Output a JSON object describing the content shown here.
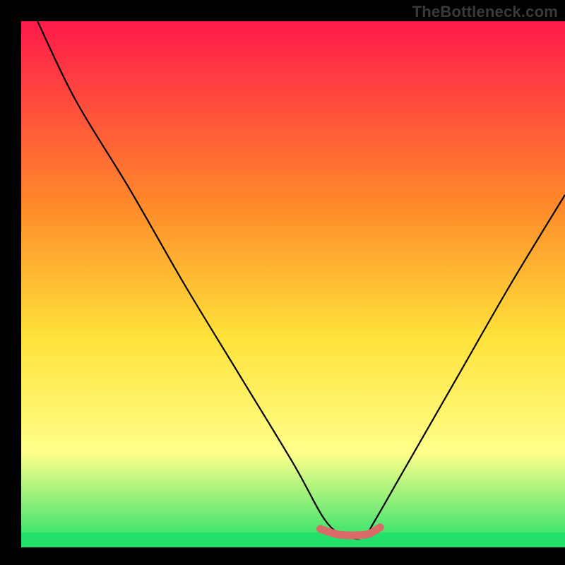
{
  "watermark": "TheBottleneck.com",
  "chart_data": {
    "type": "line",
    "title": "",
    "xlabel": "",
    "ylabel": "",
    "xlim": [
      0,
      100
    ],
    "ylim": [
      0,
      100
    ],
    "background_gradient": {
      "top": "#FF1A4B",
      "mid1": "#FF8A2A",
      "mid2": "#FFE23A",
      "mid3": "#FFFF8A",
      "bottom": "#22E06A"
    },
    "series": [
      {
        "name": "bottleneck-curve",
        "x": [
          3,
          10,
          20,
          30,
          40,
          50,
          56,
          60,
          63,
          65,
          70,
          80,
          90,
          100
        ],
        "y": [
          100,
          85,
          68,
          50,
          33,
          16,
          5,
          2,
          2,
          5,
          14,
          32,
          50,
          67
        ]
      },
      {
        "name": "optimal-band",
        "x": [
          55,
          58,
          60,
          62,
          64,
          66
        ],
        "y": [
          3.5,
          2.5,
          2.3,
          2.3,
          2.6,
          3.8
        ]
      }
    ],
    "optimal_band_color": "#D96A66",
    "curve_color": "#000000",
    "green_band_y": 2
  }
}
